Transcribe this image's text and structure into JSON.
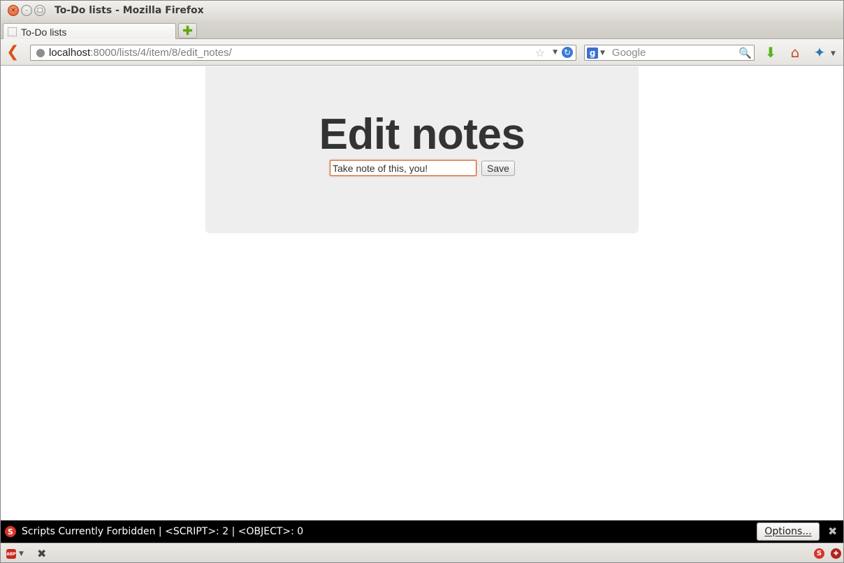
{
  "window": {
    "title": "To-Do lists - Mozilla Firefox",
    "controls": {
      "close": "×",
      "minimize": "–",
      "maximize": "□"
    }
  },
  "tabs": [
    {
      "label": "To-Do lists"
    }
  ],
  "newtab": {
    "glyph": "✚"
  },
  "navbar": {
    "back_glyph": "❮",
    "url_host": "localhost",
    "url_rest": ":8000/lists/4/item/8/edit_notes/",
    "star_glyph": "☆",
    "reload_glyph": "↻",
    "search_engine_glyph": "g",
    "search_placeholder": "Google",
    "search_icon_glyph": "🔍",
    "download_glyph": "⬇",
    "home_glyph": "⌂",
    "extra_glyph": "✦"
  },
  "page": {
    "heading": "Edit notes",
    "notes_value": "Take note of this, you!",
    "save_label": "Save"
  },
  "noscript": {
    "icon": "S",
    "message": "Scripts Currently Forbidden | <SCRIPT>: 2 | <OBJECT>: 0",
    "options_label": "Options...",
    "close_glyph": "✖"
  },
  "statusbar": {
    "abp_label": "ABP",
    "close_glyph": "✖",
    "noscript_icon": "S",
    "other_icon": "✚"
  },
  "colors": {
    "accent_input_border": "#d05a20",
    "jumbotron_bg": "#eeeeee",
    "noscript_bar_bg": "#000000"
  }
}
